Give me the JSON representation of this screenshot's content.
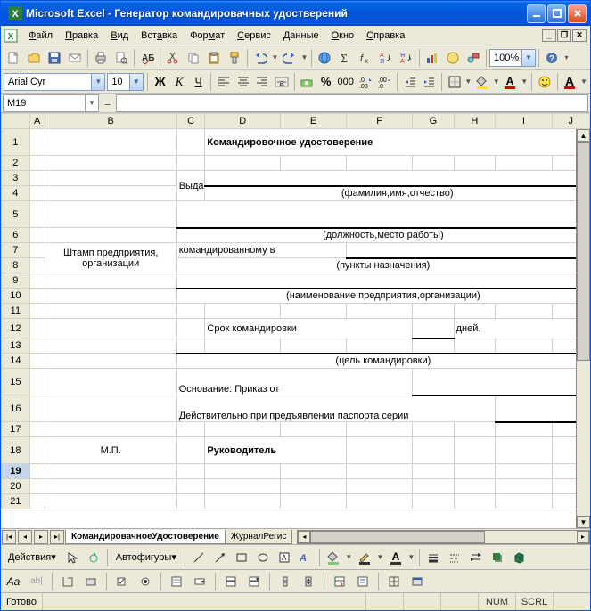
{
  "titlebar": {
    "app": "Microsoft Excel",
    "doc": "Генератор командировачных удостверений"
  },
  "menu": {
    "file": "Файл",
    "edit": "Правка",
    "view": "Вид",
    "insert": "Вставка",
    "format": "Формат",
    "tools": "Сервис",
    "data": "Данные",
    "window": "Окно",
    "help": "Справка"
  },
  "font": {
    "name": "Arial Cyr",
    "size": "10"
  },
  "zoom": "100%",
  "namebox": "M19",
  "cols": [
    "A",
    "B",
    "C",
    "D",
    "E",
    "F",
    "G",
    "H",
    "I",
    "J"
  ],
  "rows": [
    "1",
    "2",
    "3",
    "4",
    "5",
    "6",
    "7",
    "8",
    "9",
    "10",
    "11",
    "12",
    "13",
    "14",
    "15",
    "16",
    "17",
    "18",
    "19",
    "20",
    "21"
  ],
  "cells": {
    "title": "Командировочное удостоверение",
    "vydano": "Выдано",
    "fio": "(фамилия,имя,отчество)",
    "dolzh": "(должность,место работы)",
    "stamp": "Штамп предприятия, организации",
    "komand": "командированному в",
    "punkty": "(пункты назначения)",
    "naim": "(наименование предприятия,организации)",
    "srok": "Срок командировки",
    "dney": "дней.",
    "cel": "(цель командировки)",
    "osn": "Основание: Приказ от",
    "deist": "Действительно при предъявлении паспорта серии",
    "mp": "М.П.",
    "ruk": "Руководитель"
  },
  "tabs": {
    "t1": "КомандировачноеУдостоверение",
    "t2": "ЖурналРегис"
  },
  "drawbar": {
    "actions": "Действия",
    "autoshapes": "Автофигуры"
  },
  "status": {
    "ready": "Готово",
    "num": "NUM",
    "scrl": "SCRL"
  }
}
